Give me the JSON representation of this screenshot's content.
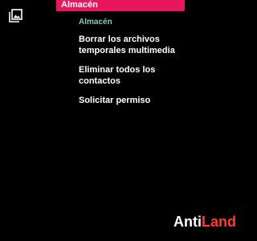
{
  "header": {
    "title": "Almacén",
    "icon": "gallery-icon",
    "accent_color": "#e8175d"
  },
  "settings": {
    "section_title": "Almacén",
    "section_color": "#8ec7bf",
    "items": [
      {
        "line1": "Borrar los archivos",
        "line2": "temporales multimedia"
      },
      {
        "line1": "Eliminar todos los",
        "line2": "contactos"
      },
      {
        "line1": "Solicitar permiso",
        "line2": ""
      }
    ]
  },
  "watermark": {
    "part1": "Anti",
    "part2": "Land",
    "part2_color": "#ff3d2b"
  }
}
